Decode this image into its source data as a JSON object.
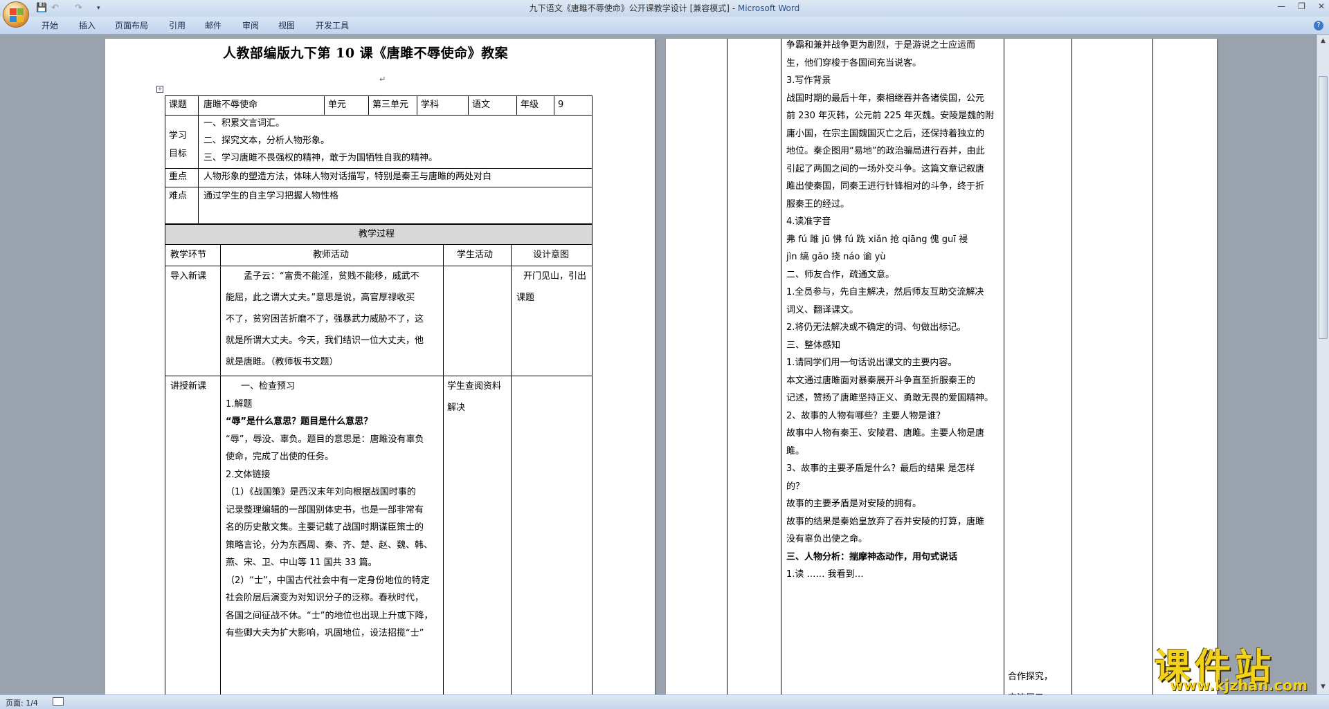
{
  "window": {
    "title": "九下语文《唐雎不辱使命》公开课教学设计 [兼容模式] - ",
    "app_name": "Microsoft Word",
    "quick_access": [
      "save-icon",
      "undo-icon",
      "redo-icon"
    ]
  },
  "ribbon": {
    "tabs": [
      "开始",
      "插入",
      "页面布局",
      "引用",
      "邮件",
      "审阅",
      "视图",
      "开发工具"
    ]
  },
  "status": {
    "page": "页面: 1/4"
  },
  "doc": {
    "title": "人教部编版九下第 10 课《唐雎不辱使命》教案",
    "info": {
      "k_topic": "课题",
      "v_topic": "唐雎不辱使命",
      "k_unit": "单元",
      "v_unit": "第三单元",
      "k_subject": "学科",
      "v_subject": "语文",
      "k_grade": "年级",
      "v_grade": "9"
    },
    "goals_label": [
      "学习",
      "目标"
    ],
    "goals": [
      "一、积累文言词汇。",
      "二、探究文本，分析人物形象。",
      "三、学习唐雎不畏强权的精神，敢于为国牺牲自我的精神。"
    ],
    "key_label": "重点",
    "key": "人物形象的塑造方法，体味人物对话描写，特别是秦王与唐雎的两处对白",
    "diff_label": "难点",
    "diff": "通过学生的自主学习把握人物性格",
    "process_header": "教学过程",
    "cols": [
      "教学环节",
      "教师活动",
      "学生活动",
      "设计意图"
    ],
    "row1": {
      "stage": "导入新课",
      "teacher": [
        "孟子云：“富贵不能淫，贫贱不能移，威武不",
        "能屈，此之谓大丈夫。”意思是说，高官厚禄收买",
        "不了，贫穷困苦折磨不了，强暴武力威胁不了，这",
        "就是所谓大丈夫。今天，我们结识一位大丈夫，他",
        "就是唐雎。（教师板书文题）"
      ],
      "intent": [
        "开门见山，引出",
        "课题"
      ]
    },
    "row2": {
      "stage": "讲授新课",
      "student": [
        "学生查阅资料",
        "解决"
      ],
      "teacher": [
        "一、检查预习",
        "1.解题",
        "“辱”是什么意思？题目是什么意思？",
        "“辱”，辱没、辜负。题目的意思是：唐雎没有辜负",
        "使命，完成了出使的任务。",
        "2.文体链接",
        "（1）《战国策》是西汉末年刘向根据战国时事的",
        "记录整理编辑的一部国别体史书，也是一部非常有",
        "名的历史散文集。主要记载了战国时期谋臣策士的",
        "策略言论，分为东西周、秦、齐、楚、赵、魏、韩、",
        "燕、宋、卫、中山等 11 国共 33 篇。",
        "（2）“士”，中国古代社会中有一定身份地位的特定",
        "社会阶层后演变为对知识分子的泛称。春秋时代，",
        "各国之间征战不休。“士”的地位也出现上升或下降，",
        "有些卿大夫为扩大影响，巩固地位，设法招揽“士”"
      ]
    },
    "right_col": [
      "争霸和兼并战争更为剧烈，于是游说之士应运而",
      "生，他们穿梭于各国间充当说客。",
      "3.写作背景",
      "战国时期的最后十年，秦相继吞并各诸侯国，公元",
      "前 230 年灭韩，公元前 225 年灭魏。安陵是魏的附",
      "庸小国，在宗主国魏国灭亡之后，还保持着独立的",
      "地位。秦企图用“易地”的政治骗局进行吞并，由此",
      "引起了两国之间的一场外交斗争。这篇文章记叙唐",
      "雎出使秦国，同秦王进行针锋相对的斗争，终于折",
      "服秦王的经过。",
      "4.读准字音",
      "弗 fú 雎 jū  怫 fú  跣 xiǎn  抢 qiāng  傀 guī  祲",
      "jìn  缟 gǎo  挠 náo  谕 yù",
      "二、师友合作，疏通文意。",
      "1.全员参与，先自主解决，然后师友互助交流解决",
      "词义、翻译课文。",
      "2.将仍无法解决或不确定的词、句做出标记。",
      "三、整体感知",
      "1.请同学们用一句话说出课文的主要内容。",
      "本文通过唐雎面对暴秦展开斗争直至折服秦王的",
      "记述，赞扬了唐雎坚持正义、勇敢无畏的爱国精神。",
      "2、故事的人物有哪些？主要人物是谁？",
      "故事中人物有秦王、安陵君、唐雎。主要人物是唐",
      "雎。",
      "3、故事的主要矛盾是什么？最后的结果 是怎样",
      "的？",
      "故事的主要矛盾是对安陵的拥有。",
      "故事的结果是秦始皇放弃了吞并安陵的打算，唐雎",
      "没有辜负出使之命。",
      "三、人物分析：揣摩神态动作，用句式说话",
      "1.读 ……  我看到…"
    ],
    "right_student": [
      "合作探究，",
      "交流展示"
    ]
  },
  "watermark": {
    "text": "课件站",
    "url": "www.kjzhan.com"
  }
}
